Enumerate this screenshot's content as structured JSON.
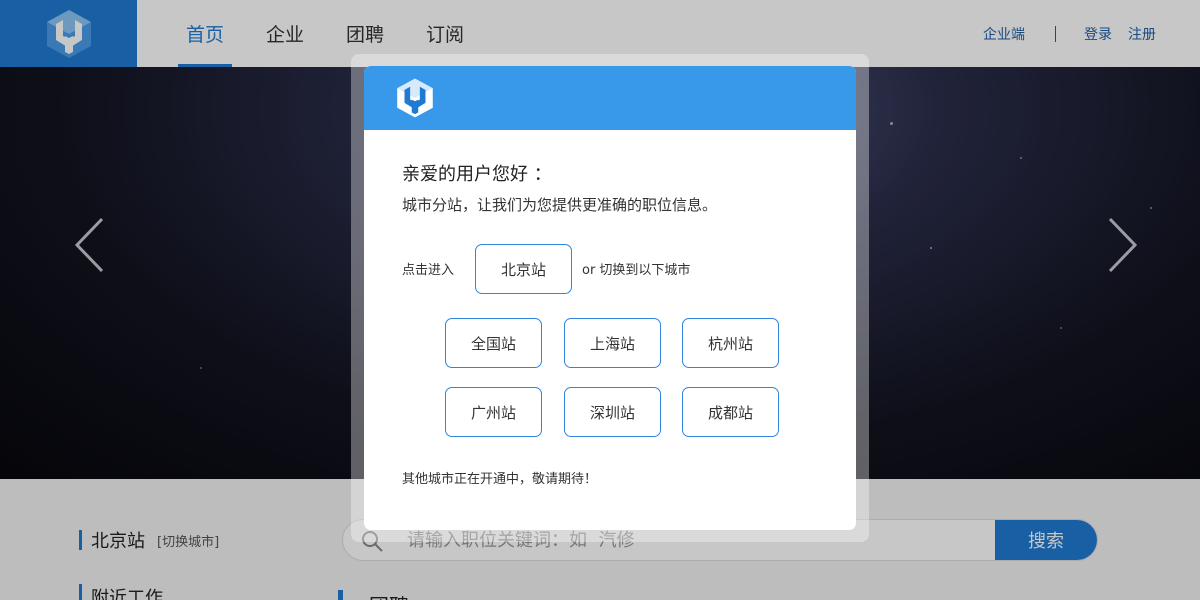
{
  "header": {
    "nav": [
      {
        "label": "首页",
        "active": true
      },
      {
        "label": "企业"
      },
      {
        "label": "团聘"
      },
      {
        "label": "订阅"
      }
    ],
    "enterprise_link": "企业端",
    "login": "登录",
    "register": "注册"
  },
  "page": {
    "city_name": "北京站",
    "switch_city": "[切换城市]",
    "nearby_jobs": "附近工作",
    "search_placeholder": "请输入职位关键词：如  汽修",
    "search_button": "搜索",
    "section_title": "团聘"
  },
  "modal": {
    "greeting": "亲爱的用户您好 ：",
    "intro": "城市分站，让我们为您提供更准确的职位信息。",
    "enter_label": "点击进入",
    "current_city": "北京站",
    "switch_label": "or  切换到以下城市",
    "cities": [
      "全国站",
      "上海站",
      "杭州站",
      "广州站",
      "深圳站",
      "成都站"
    ],
    "note": "其他城市正在开通中，敬请期待！"
  },
  "colors": {
    "brand_blue": "#1f7bd1",
    "modal_header": "#3899eb",
    "button_border": "#2f86dc"
  }
}
